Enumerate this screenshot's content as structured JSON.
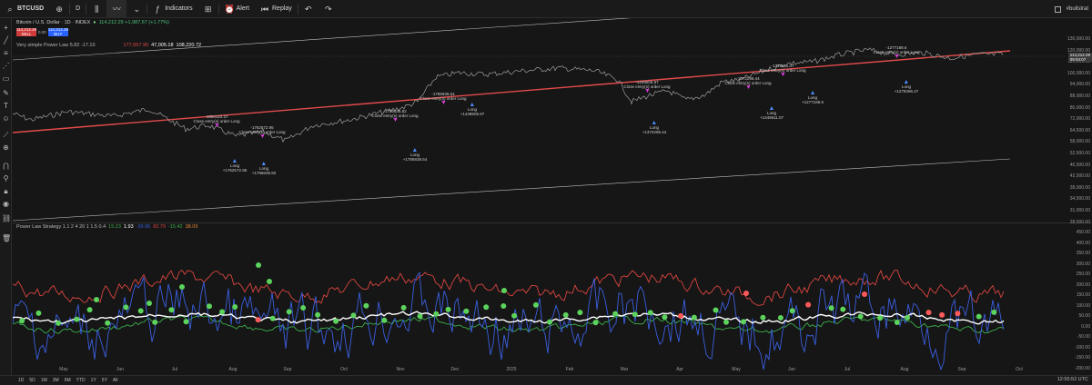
{
  "toolbar": {
    "symbol": "BTCUSD",
    "interval": "D",
    "indicators_label": "Indicators",
    "alert_label": "Alert",
    "replay_label": "Replay",
    "right_label": "#bullstrat"
  },
  "legend_main": {
    "title": "Bitcoin / U.S. Dollar · 1D · INDEX",
    "ohlc": "114,212.29 +1,987.67 (+1.77%)",
    "sell_price": "114,212.29",
    "sell_label": "SELL",
    "spread": "0.00",
    "buy_price": "114,212.29",
    "buy_label": "BUY"
  },
  "legend_powerlaw": {
    "title": "Very simple Power Law 5.82 -17.10",
    "v1": "177,657.90",
    "v2": "47,005.18",
    "v3": "108,220.72"
  },
  "legend_strategy": {
    "title": "Power Law Strategy 1.1 2 4 20 1 1.5 0.4",
    "v1": "15.23",
    "v2": "1.93",
    "v3": "-39.96",
    "v4": "82.79",
    "v5": "-15.42",
    "v6": "38.09"
  },
  "price_axis": [
    "130,000.00",
    "120,000.00",
    "110,000.00",
    "100,000.00",
    "94,000.00",
    "88,000.00",
    "80,000.00",
    "72,000.00",
    "64,500.00",
    "58,000.00",
    "52,500.00",
    "46,500.00",
    "42,500.00",
    "38,000.00",
    "34,500.00",
    "31,000.00",
    "28,500.00"
  ],
  "price_tag": "114,212.29",
  "price_tag_sub": "09:04:07",
  "osc_axis": [
    "450.00",
    "400.00",
    "350.00",
    "300.00",
    "250.00",
    "200.00",
    "150.00",
    "100.00",
    "50.00",
    "0.00",
    "-50.00",
    "-100.00",
    "-150.00",
    "-200.00"
  ],
  "time_axis": [
    "May",
    "Jun",
    "Jul",
    "Aug",
    "Sep",
    "Oct",
    "Nov",
    "Dec",
    "2025",
    "Feb",
    "Mar",
    "Apr",
    "May",
    "Jun",
    "Jul",
    "Aug",
    "Sep",
    "Oct"
  ],
  "trades": [
    {
      "text1": "-1854122.27",
      "text2": "Close entry(s) order Long"
    },
    {
      "text1": "-1762572.95",
      "text2": "Close entry(s) order Long"
    },
    {
      "text1": "Long",
      "text2": "+1762572.95"
    },
    {
      "text1": "Long",
      "text2": "+1786635.82"
    },
    {
      "text1": "-1786635.82",
      "text2": "Close entry(s) order Long"
    },
    {
      "text1": "Long",
      "text2": "+1786938.64"
    },
    {
      "text1": "-1786938.64",
      "text2": "Close entry(s) order Long"
    },
    {
      "text1": "Long",
      "text2": "+1448605.97"
    },
    {
      "text1": "-1448605.97",
      "text2": "Close entry(s) order Long"
    },
    {
      "text1": "Long",
      "text2": "+1372296.44"
    },
    {
      "text1": "-1372296.44",
      "text2": "Close entry(s) order Long"
    },
    {
      "text1": "-1349611.07",
      "text2": "Close entry(s) order Long"
    },
    {
      "text1": "Long",
      "text2": "+1349611.07"
    },
    {
      "text1": "Long",
      "text2": "+1277188.6"
    },
    {
      "text1": "-1277188.6",
      "text2": "Close entry(s) order Long"
    },
    {
      "text1": "Long",
      "text2": "+1279396.27"
    }
  ],
  "bottom_ranges": [
    "1D",
    "5D",
    "1M",
    "3M",
    "6M",
    "YTD",
    "1Y",
    "5Y",
    "All"
  ],
  "clock": "12:55:52 UTC",
  "colors": {
    "background": "#161616",
    "price_line": "#9e9e9e",
    "power_law": "#e34b4b",
    "channel": "#bdbdbd",
    "osc_red": "#d9453f",
    "osc_blue": "#3a5fe0",
    "osc_white": "#ffffff",
    "osc_green": "#3cae4a",
    "dot_green": "#5cd35c",
    "dot_red": "#ff5a5a",
    "sell": "#d23b3b",
    "buy": "#2962ff"
  }
}
